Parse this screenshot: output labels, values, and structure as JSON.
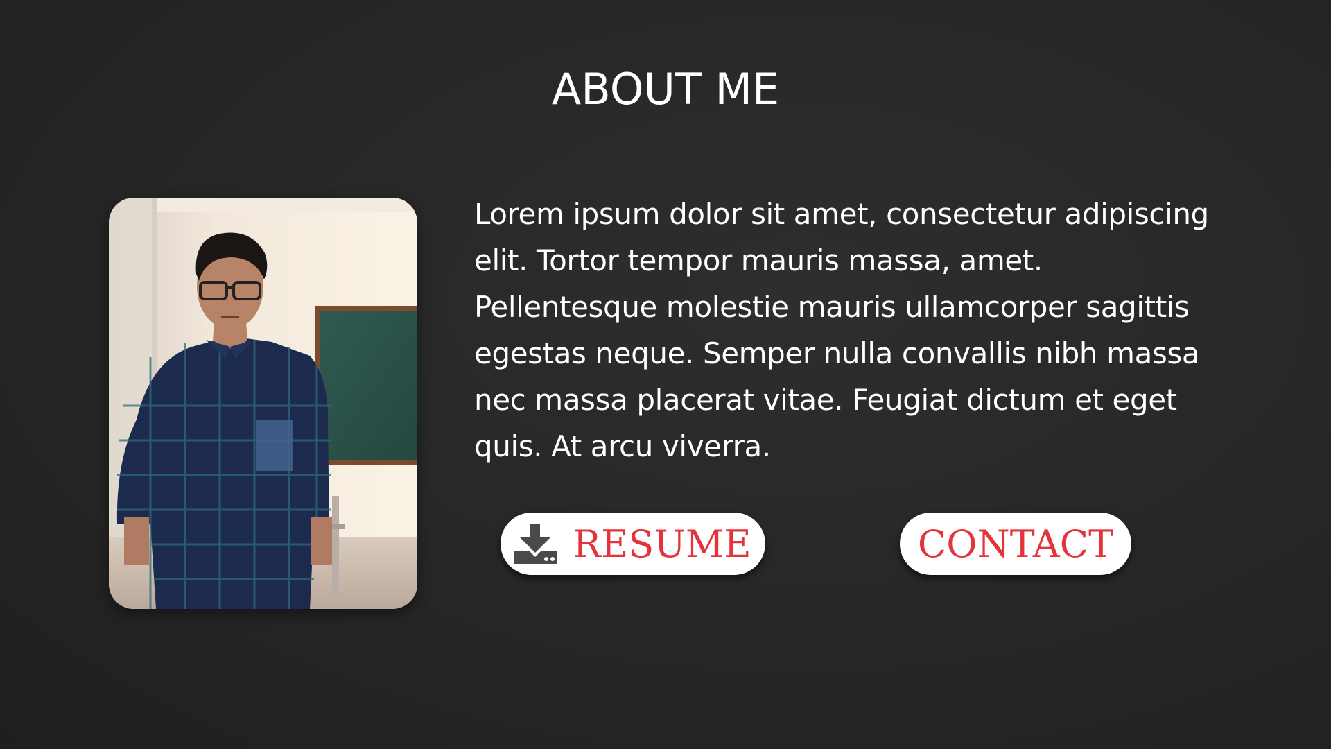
{
  "page": {
    "title": "ABOUT ME"
  },
  "about": {
    "bio": "Lorem ipsum dolor sit amet, consectetur adipiscing elit. Tortor tempor mauris massa, amet. Pellentesque molestie mauris ullamcorper sagittis egestas neque. Semper nulla convallis nibh massa nec massa placerat vitae. Feugiat dictum et eget quis. At arcu viverra."
  },
  "buttons": {
    "resume_label": "RESUME",
    "contact_label": "CONTACT"
  },
  "icons": {
    "resume": "download-icon"
  },
  "colors": {
    "background": "#262626",
    "text": "#ffffff",
    "button_background": "#ffffff",
    "button_text": "#e5333b",
    "icon": "#4a4a4a"
  }
}
